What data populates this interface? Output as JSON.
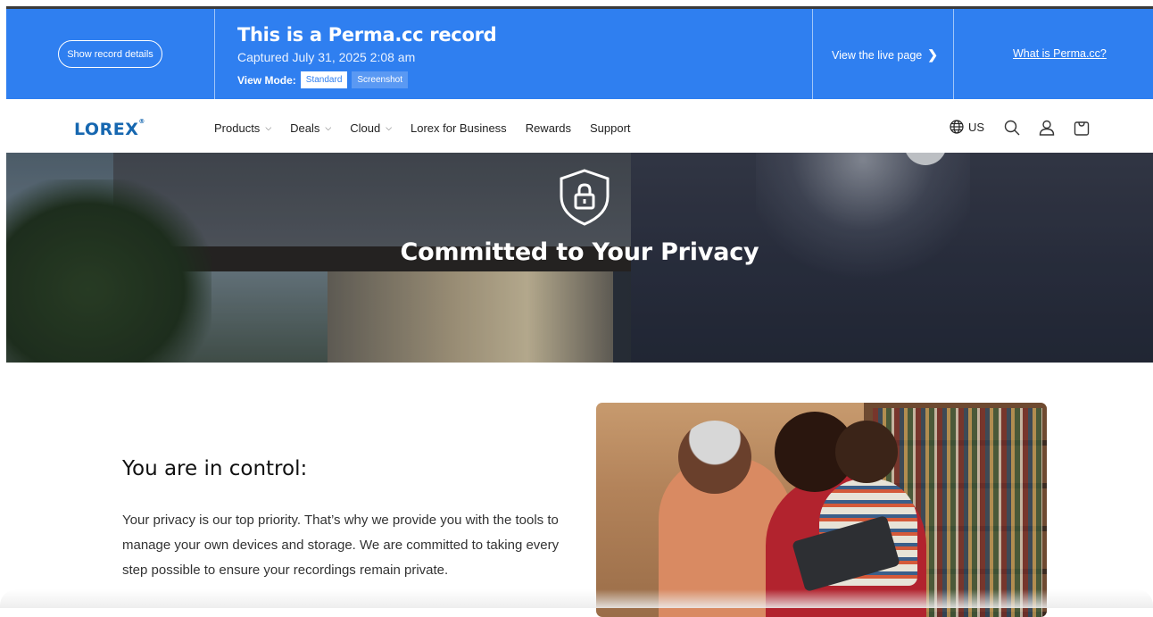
{
  "perma": {
    "details_button": "Show record details",
    "title": "This is a Perma.cc record",
    "captured": "Captured July 31, 2025 2:08 am",
    "view_mode_label": "View Mode:",
    "view_modes": [
      "Standard",
      "Screenshot"
    ],
    "active_view_mode": "Standard",
    "live_page_link": "View the live page",
    "what_is_link": "What is Perma.cc?",
    "banner_color": "#2f7ff0"
  },
  "nav": {
    "logo": "LOREX",
    "logo_mark": "®",
    "menu": [
      {
        "label": "Products",
        "has_dropdown": true
      },
      {
        "label": "Deals",
        "has_dropdown": true
      },
      {
        "label": "Cloud",
        "has_dropdown": true
      },
      {
        "label": "Lorex for Business",
        "has_dropdown": false
      },
      {
        "label": "Rewards",
        "has_dropdown": false
      },
      {
        "label": "Support",
        "has_dropdown": false
      }
    ],
    "caret_glyph": "⌵",
    "region": "US",
    "icons": [
      "globe-icon",
      "search-icon",
      "account-icon",
      "cart-icon"
    ],
    "brand_color": "#1667b0"
  },
  "hero": {
    "icon": "shield-lock-icon",
    "title": "Committed to Your Privacy"
  },
  "content": {
    "heading": "You are in control:",
    "body": "Your privacy is our top priority. That’s why we provide you with the tools to manage your own devices and storage. We are committed to taking every step possible to ensure your recordings remain private."
  }
}
